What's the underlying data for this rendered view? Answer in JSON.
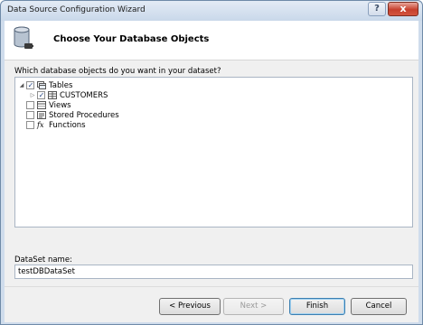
{
  "window": {
    "title": "Data Source Configuration Wizard"
  },
  "header": {
    "title": "Choose Your Database Objects",
    "icon": "database-connection-icon"
  },
  "objects": {
    "prompt": "Which database objects do you want in your dataset?",
    "tree": [
      {
        "label": "Tables",
        "checked": true,
        "expanded": true,
        "icon": "tables-icon"
      },
      {
        "label": "CUSTOMERS",
        "checked": true,
        "expanded": false,
        "icon": "table-icon"
      },
      {
        "label": "Views",
        "checked": false,
        "icon": "views-icon"
      },
      {
        "label": "Stored Procedures",
        "checked": false,
        "icon": "stored-procedure-icon"
      },
      {
        "label": "Functions",
        "checked": false,
        "icon": "function-icon",
        "icon_text": "fx"
      }
    ]
  },
  "dataset": {
    "label": "DataSet name:",
    "value": "testDBDataSet"
  },
  "buttons": {
    "previous": "< Previous",
    "next": "Next >",
    "finish": "Finish",
    "cancel": "Cancel"
  },
  "titlebar_buttons": {
    "help": "?",
    "close": "x"
  },
  "colors": {
    "accent": "#3c7fb1",
    "close": "#c7402d"
  }
}
